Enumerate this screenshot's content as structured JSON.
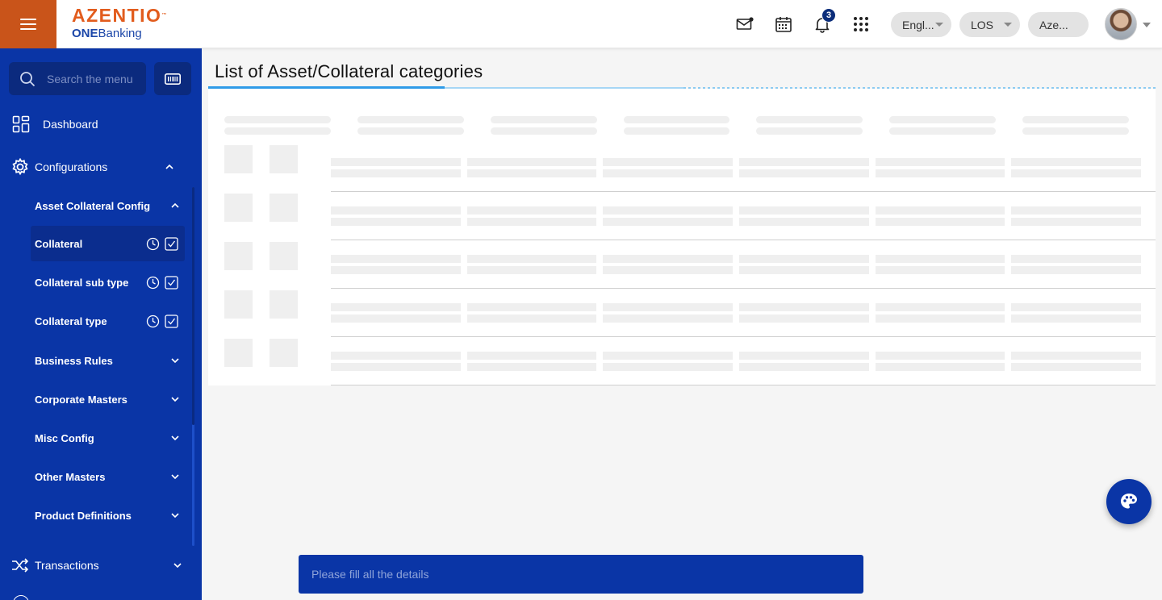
{
  "header": {
    "logo_brand": "AZENTIO",
    "logo_tm": "™",
    "logo_sub_bold": "ONE",
    "logo_sub_rest": "Banking",
    "notification_count": "3",
    "language_label": "Engl...",
    "module_label": "LOS",
    "entity_label": "Aze..."
  },
  "sidebar": {
    "search_placeholder": "Search the menu",
    "items": [
      {
        "label": "Dashboard"
      },
      {
        "label": "Configurations"
      },
      {
        "label": "Transactions"
      }
    ],
    "config_children": [
      {
        "label": "Asset Collateral Config"
      },
      {
        "label": "Collateral"
      },
      {
        "label": "Collateral sub type"
      },
      {
        "label": "Collateral type"
      },
      {
        "label": "Business Rules"
      },
      {
        "label": "Corporate Masters"
      },
      {
        "label": "Misc Config"
      },
      {
        "label": "Other Masters"
      },
      {
        "label": "Product Definitions"
      }
    ]
  },
  "main": {
    "title": "List of Asset/Collateral categories"
  },
  "toast": {
    "message": "Please fill all the details"
  },
  "colors": {
    "sidebar_bg": "#0a35a6",
    "brand_orange": "#e25c1d",
    "accent_blue": "#2f9be8"
  }
}
